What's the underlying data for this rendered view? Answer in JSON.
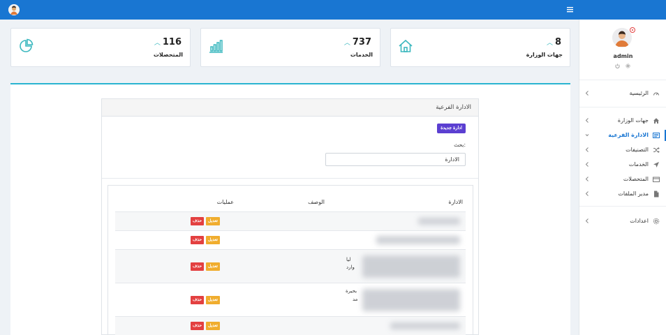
{
  "topbar": {
    "menu_icon": "hamburger-icon",
    "avatar_icon": "user-avatar-icon"
  },
  "stats": [
    {
      "value": "8",
      "label": "جهات الوزارة",
      "icon": "home-icon",
      "color": "#3cb8bf"
    },
    {
      "value": "737",
      "label": "الخدمات",
      "icon": "bar-chart-icon",
      "color": "#3cb8bf"
    },
    {
      "value": "116",
      "label": "المتحصلات",
      "icon": "pie-chart-icon",
      "color": "#3cb8bf"
    }
  ],
  "panel": {
    "title": "الادارة الفرعية",
    "new_button": "ادارة جديدة",
    "search_label": "بحث:",
    "search_value": "الادارة"
  },
  "table": {
    "headers": {
      "name": "الادارة",
      "desc": "الوصف",
      "ops": "عمليات"
    },
    "edit_label": "تعديل",
    "delete_label": "حذف",
    "rows": [
      {
        "desc_lines": []
      },
      {
        "desc_lines": []
      },
      {
        "desc_lines": [
          "ليا",
          "وارد"
        ]
      },
      {
        "desc_lines": [
          "بحيرة",
          "مد"
        ]
      },
      {
        "desc_lines": []
      }
    ]
  },
  "sidebar": {
    "user_name": "admin",
    "items": [
      {
        "label": "الرئيسية",
        "icon": "dashboard-icon"
      },
      {
        "label": "جهات الوزارة",
        "icon": "home-icon"
      },
      {
        "label": "الادارة الفرعية",
        "icon": "list-icon",
        "active": true
      },
      {
        "label": "التصنيفات",
        "icon": "shuffle-icon"
      },
      {
        "label": "الخدمات",
        "icon": "send-icon"
      },
      {
        "label": "المتحصلات",
        "icon": "credit-card-icon"
      },
      {
        "label": "مدير الملفات",
        "icon": "file-icon"
      },
      {
        "label": "اعدادات",
        "icon": "settings-icon"
      }
    ]
  },
  "colors": {
    "primary": "#1976d2",
    "accent": "#3cb8bf",
    "edit": "#f0ad2e",
    "delete": "#e34040",
    "new": "#5b3fd1"
  }
}
